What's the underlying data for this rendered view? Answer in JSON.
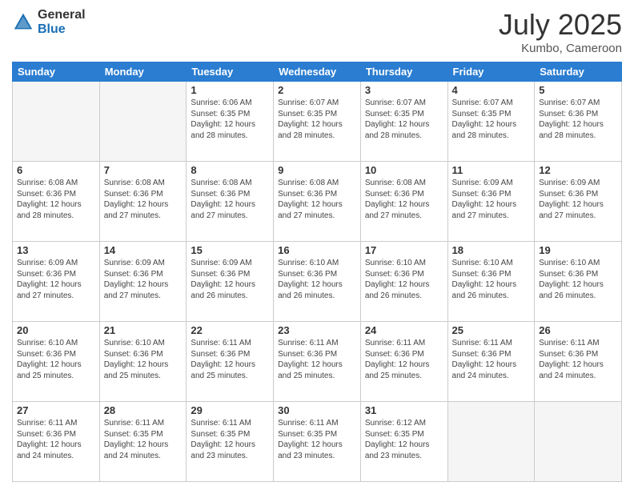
{
  "logo": {
    "general": "General",
    "blue": "Blue"
  },
  "title": "July 2025",
  "location": "Kumbo, Cameroon",
  "days_of_week": [
    "Sunday",
    "Monday",
    "Tuesday",
    "Wednesday",
    "Thursday",
    "Friday",
    "Saturday"
  ],
  "weeks": [
    [
      {
        "day": null
      },
      {
        "day": null
      },
      {
        "day": "1",
        "sunrise": "Sunrise: 6:06 AM",
        "sunset": "Sunset: 6:35 PM",
        "daylight": "Daylight: 12 hours and 28 minutes."
      },
      {
        "day": "2",
        "sunrise": "Sunrise: 6:07 AM",
        "sunset": "Sunset: 6:35 PM",
        "daylight": "Daylight: 12 hours and 28 minutes."
      },
      {
        "day": "3",
        "sunrise": "Sunrise: 6:07 AM",
        "sunset": "Sunset: 6:35 PM",
        "daylight": "Daylight: 12 hours and 28 minutes."
      },
      {
        "day": "4",
        "sunrise": "Sunrise: 6:07 AM",
        "sunset": "Sunset: 6:35 PM",
        "daylight": "Daylight: 12 hours and 28 minutes."
      },
      {
        "day": "5",
        "sunrise": "Sunrise: 6:07 AM",
        "sunset": "Sunset: 6:36 PM",
        "daylight": "Daylight: 12 hours and 28 minutes."
      }
    ],
    [
      {
        "day": "6",
        "sunrise": "Sunrise: 6:08 AM",
        "sunset": "Sunset: 6:36 PM",
        "daylight": "Daylight: 12 hours and 28 minutes."
      },
      {
        "day": "7",
        "sunrise": "Sunrise: 6:08 AM",
        "sunset": "Sunset: 6:36 PM",
        "daylight": "Daylight: 12 hours and 27 minutes."
      },
      {
        "day": "8",
        "sunrise": "Sunrise: 6:08 AM",
        "sunset": "Sunset: 6:36 PM",
        "daylight": "Daylight: 12 hours and 27 minutes."
      },
      {
        "day": "9",
        "sunrise": "Sunrise: 6:08 AM",
        "sunset": "Sunset: 6:36 PM",
        "daylight": "Daylight: 12 hours and 27 minutes."
      },
      {
        "day": "10",
        "sunrise": "Sunrise: 6:08 AM",
        "sunset": "Sunset: 6:36 PM",
        "daylight": "Daylight: 12 hours and 27 minutes."
      },
      {
        "day": "11",
        "sunrise": "Sunrise: 6:09 AM",
        "sunset": "Sunset: 6:36 PM",
        "daylight": "Daylight: 12 hours and 27 minutes."
      },
      {
        "day": "12",
        "sunrise": "Sunrise: 6:09 AM",
        "sunset": "Sunset: 6:36 PM",
        "daylight": "Daylight: 12 hours and 27 minutes."
      }
    ],
    [
      {
        "day": "13",
        "sunrise": "Sunrise: 6:09 AM",
        "sunset": "Sunset: 6:36 PM",
        "daylight": "Daylight: 12 hours and 27 minutes."
      },
      {
        "day": "14",
        "sunrise": "Sunrise: 6:09 AM",
        "sunset": "Sunset: 6:36 PM",
        "daylight": "Daylight: 12 hours and 27 minutes."
      },
      {
        "day": "15",
        "sunrise": "Sunrise: 6:09 AM",
        "sunset": "Sunset: 6:36 PM",
        "daylight": "Daylight: 12 hours and 26 minutes."
      },
      {
        "day": "16",
        "sunrise": "Sunrise: 6:10 AM",
        "sunset": "Sunset: 6:36 PM",
        "daylight": "Daylight: 12 hours and 26 minutes."
      },
      {
        "day": "17",
        "sunrise": "Sunrise: 6:10 AM",
        "sunset": "Sunset: 6:36 PM",
        "daylight": "Daylight: 12 hours and 26 minutes."
      },
      {
        "day": "18",
        "sunrise": "Sunrise: 6:10 AM",
        "sunset": "Sunset: 6:36 PM",
        "daylight": "Daylight: 12 hours and 26 minutes."
      },
      {
        "day": "19",
        "sunrise": "Sunrise: 6:10 AM",
        "sunset": "Sunset: 6:36 PM",
        "daylight": "Daylight: 12 hours and 26 minutes."
      }
    ],
    [
      {
        "day": "20",
        "sunrise": "Sunrise: 6:10 AM",
        "sunset": "Sunset: 6:36 PM",
        "daylight": "Daylight: 12 hours and 25 minutes."
      },
      {
        "day": "21",
        "sunrise": "Sunrise: 6:10 AM",
        "sunset": "Sunset: 6:36 PM",
        "daylight": "Daylight: 12 hours and 25 minutes."
      },
      {
        "day": "22",
        "sunrise": "Sunrise: 6:11 AM",
        "sunset": "Sunset: 6:36 PM",
        "daylight": "Daylight: 12 hours and 25 minutes."
      },
      {
        "day": "23",
        "sunrise": "Sunrise: 6:11 AM",
        "sunset": "Sunset: 6:36 PM",
        "daylight": "Daylight: 12 hours and 25 minutes."
      },
      {
        "day": "24",
        "sunrise": "Sunrise: 6:11 AM",
        "sunset": "Sunset: 6:36 PM",
        "daylight": "Daylight: 12 hours and 25 minutes."
      },
      {
        "day": "25",
        "sunrise": "Sunrise: 6:11 AM",
        "sunset": "Sunset: 6:36 PM",
        "daylight": "Daylight: 12 hours and 24 minutes."
      },
      {
        "day": "26",
        "sunrise": "Sunrise: 6:11 AM",
        "sunset": "Sunset: 6:36 PM",
        "daylight": "Daylight: 12 hours and 24 minutes."
      }
    ],
    [
      {
        "day": "27",
        "sunrise": "Sunrise: 6:11 AM",
        "sunset": "Sunset: 6:36 PM",
        "daylight": "Daylight: 12 hours and 24 minutes."
      },
      {
        "day": "28",
        "sunrise": "Sunrise: 6:11 AM",
        "sunset": "Sunset: 6:35 PM",
        "daylight": "Daylight: 12 hours and 24 minutes."
      },
      {
        "day": "29",
        "sunrise": "Sunrise: 6:11 AM",
        "sunset": "Sunset: 6:35 PM",
        "daylight": "Daylight: 12 hours and 23 minutes."
      },
      {
        "day": "30",
        "sunrise": "Sunrise: 6:11 AM",
        "sunset": "Sunset: 6:35 PM",
        "daylight": "Daylight: 12 hours and 23 minutes."
      },
      {
        "day": "31",
        "sunrise": "Sunrise: 6:12 AM",
        "sunset": "Sunset: 6:35 PM",
        "daylight": "Daylight: 12 hours and 23 minutes."
      },
      {
        "day": null
      },
      {
        "day": null
      }
    ]
  ]
}
